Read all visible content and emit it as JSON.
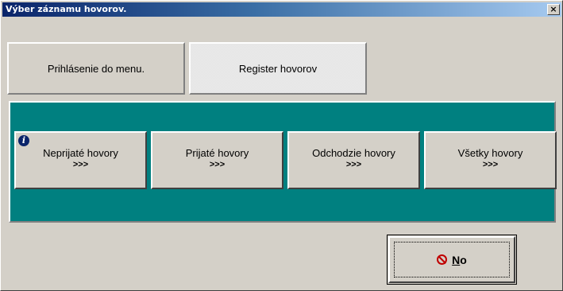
{
  "window": {
    "title": "Výber záznamu hovorov.",
    "close_glyph": "×"
  },
  "tabs": [
    {
      "label": "Prihlásenie do menu."
    },
    {
      "label": "Register hovorov"
    }
  ],
  "call_buttons": [
    {
      "label": "Neprijaté hovory",
      "arrows": ">>>",
      "icon": "info-icon"
    },
    {
      "label": "Prijaté hovory",
      "arrows": ">>>"
    },
    {
      "label": "Odchodzie hovory",
      "arrows": ">>>"
    },
    {
      "label": "Všetky hovory",
      "arrows": ">>>"
    }
  ],
  "no_button": {
    "label_first": "N",
    "label_rest": "o",
    "icon": "stop-icon"
  },
  "colors": {
    "panel": "#008080",
    "titlebar": "#0a246a",
    "face": "#d4d0c8",
    "stop": "#c00000"
  }
}
